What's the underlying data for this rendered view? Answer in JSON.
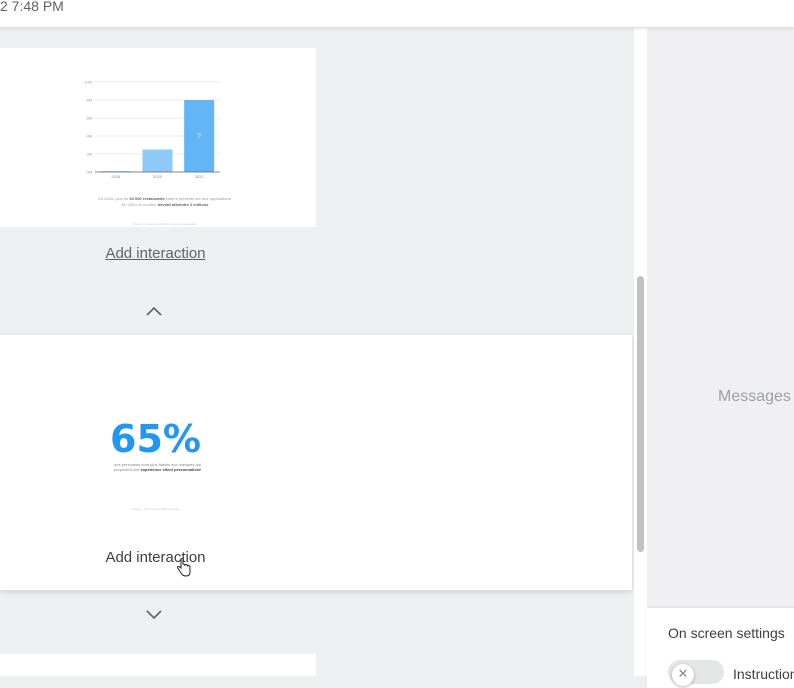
{
  "status_bar": {
    "time": "2 7:48 PM"
  },
  "slide1": {
    "chart_data": {
      "type": "bar",
      "categories": [
        "2016",
        "2020",
        "2022"
      ],
      "values": [
        0.1,
        2.5,
        8
      ],
      "bar_labels": [
        "",
        "",
        "?"
      ],
      "y_ticks": [
        "0M",
        "2M",
        "4M",
        "6M",
        "8M",
        "10M"
      ],
      "ylim": [
        0,
        10
      ],
      "bar_color": "#90caf9",
      "highlight_color": "#64b5f6"
    },
    "caption_pre": "En 2016, plus de ",
    "caption_bold": "33 000 restaurants",
    "caption_post": " étaient présents sur des applications.",
    "caption_line2_pre": "En 2020 ce nombre ",
    "caption_line2_bold": "devrait atteindre 2 millions",
    "source": "Source : lorem ipsum dolor sit amet consectetur"
  },
  "slide1_action": {
    "label": "Add interaction"
  },
  "slide2": {
    "stat": "65%",
    "desc_line1": "des personnes sont plus fidèles aux marques qui",
    "desc_line2_pre": "proposent une ",
    "desc_line2_bold": "expérience client personnalisée",
    "source": "Source : lorem ipsum dolor sit amet"
  },
  "slide2_action": {
    "label": "Add interaction"
  },
  "sidebar": {
    "messages_label": "Messages",
    "settings_title": "On screen settings",
    "toggle_label": "Instructions"
  },
  "icons": {
    "chevron_up": "chevron-up-icon",
    "chevron_down": "chevron-down-icon",
    "pointer": "hand-pointer-icon",
    "toggle_off": "close-icon"
  }
}
